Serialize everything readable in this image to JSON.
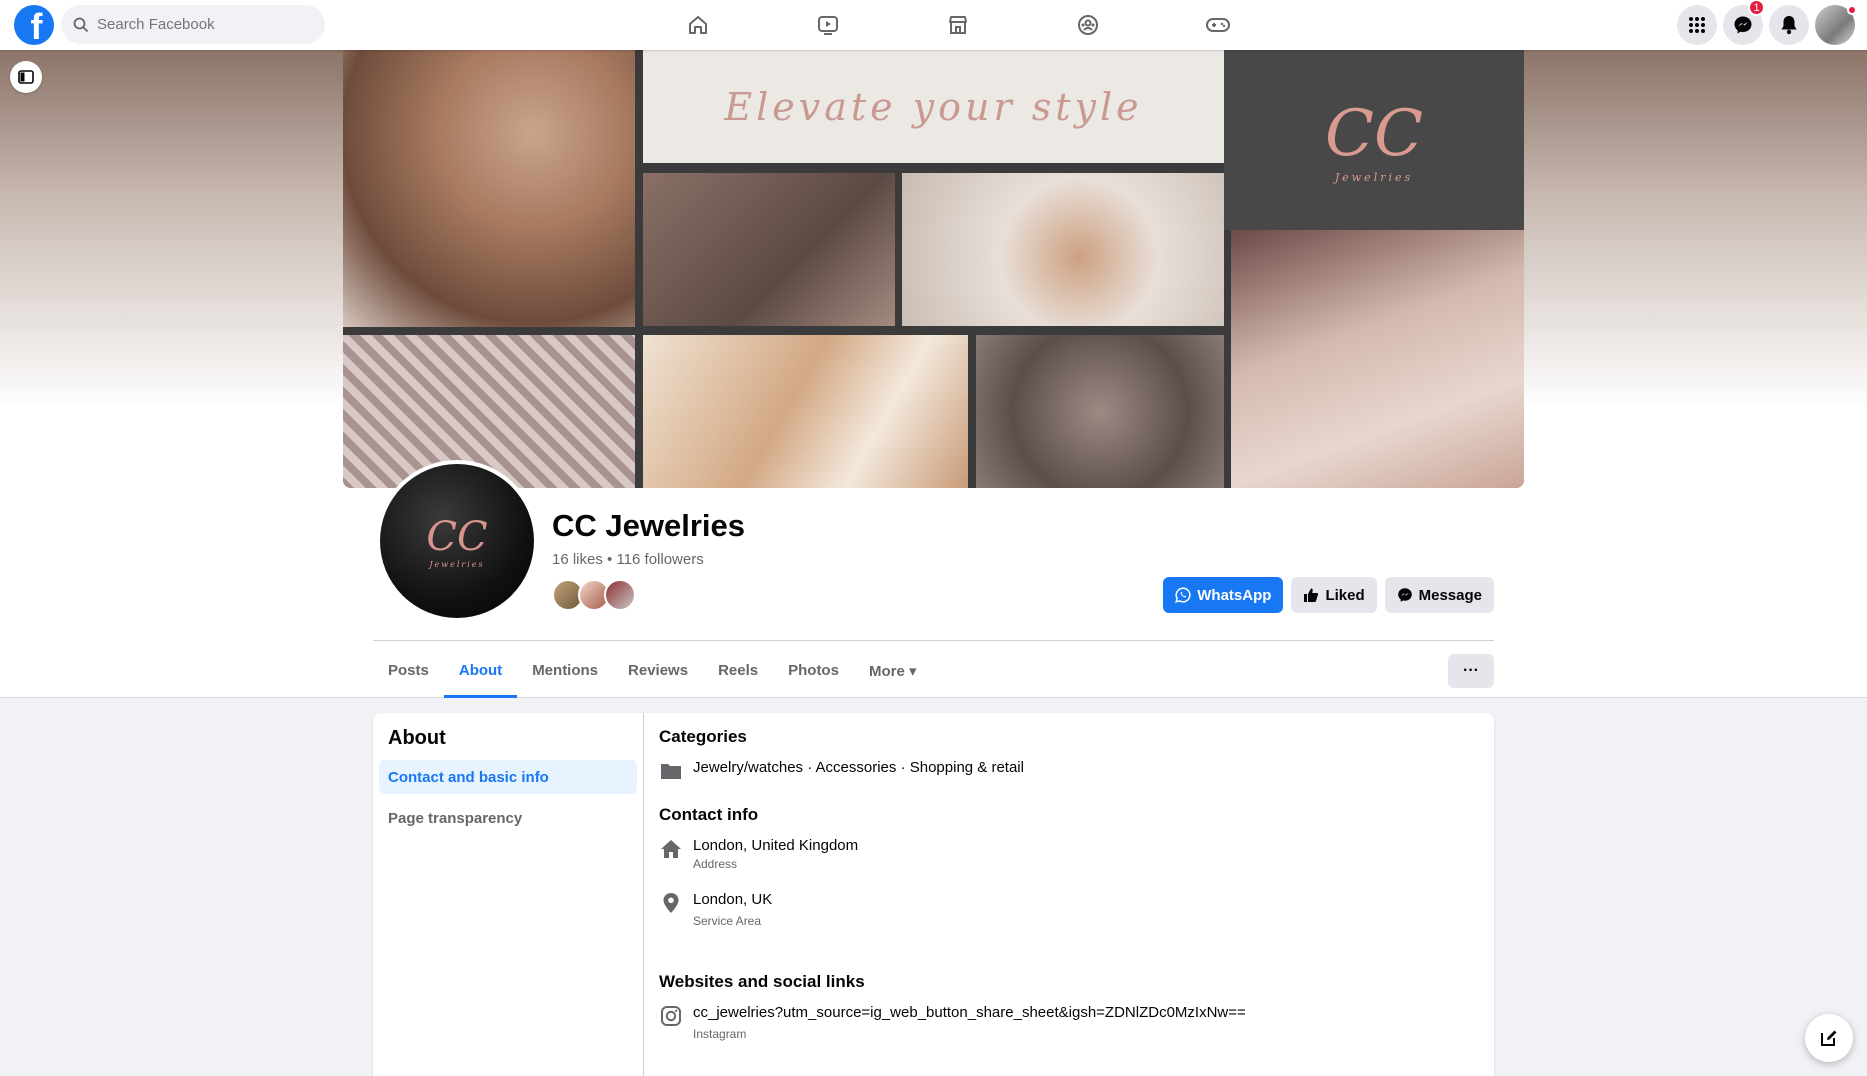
{
  "search": {
    "placeholder": "Search Facebook"
  },
  "nav": {
    "tabs": [
      "home-icon",
      "watch-icon",
      "marketplace-icon",
      "groups-icon",
      "gaming-icon"
    ],
    "messenger_badge": "1"
  },
  "cover": {
    "tagline": "Elevate your style",
    "logo_text": "CC",
    "logo_sub": "Jewelries"
  },
  "page": {
    "name": "CC Jewelries",
    "stats": "16 likes • 116 followers",
    "avatar_text": "CC",
    "avatar_sub": "Jewelries"
  },
  "actions": {
    "whatsapp": "WhatsApp",
    "liked": "Liked",
    "message": "Message"
  },
  "tabs": [
    {
      "label": "Posts",
      "active": false
    },
    {
      "label": "About",
      "active": true
    },
    {
      "label": "Mentions",
      "active": false
    },
    {
      "label": "Reviews",
      "active": false
    },
    {
      "label": "Reels",
      "active": false
    },
    {
      "label": "Photos",
      "active": false
    },
    {
      "label": "More ▾",
      "active": false
    }
  ],
  "more_dots": "···",
  "about": {
    "title": "About",
    "nav": [
      {
        "label": "Contact and basic info",
        "active": true
      },
      {
        "label": "Page transparency",
        "active": false
      }
    ],
    "categories_title": "Categories",
    "categories": "Jewelry/watches · Accessories · Shopping & retail",
    "contact_title": "Contact info",
    "address": "London, United Kingdom",
    "address_label": "Address",
    "service_area": "London, UK",
    "service_area_label": "Service Area",
    "websites_title": "Websites and social links",
    "instagram": "cc_jewelries?utm_source=ig_web_button_share_sheet&igsh=ZDNlZDc0MzIxNw==",
    "instagram_label": "Instagram"
  },
  "colors": {
    "brand": "#1877f2",
    "badge": "#e41e3f"
  }
}
